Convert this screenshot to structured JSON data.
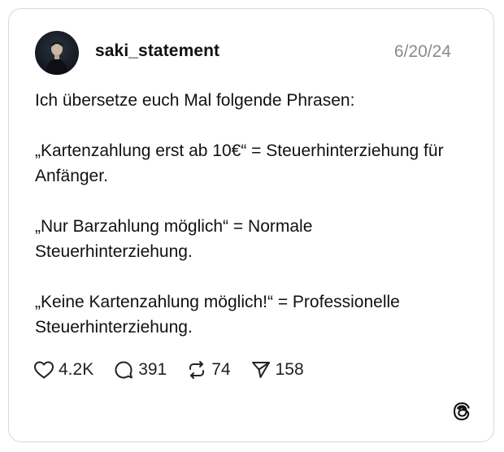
{
  "post": {
    "username": "saki_statement",
    "date": "6/20/24",
    "paragraphs": [
      "Ich übersetze euch Mal folgende Phrasen:",
      "„Kartenzahlung erst ab 10€“ = Steuerhinterziehung für Anfänger.",
      "„Nur Barzahlung möglich“ = Normale Steuerhinterziehung.",
      "„Keine Kartenzahlung möglich!“ = Professionelle Steuerhinterziehung."
    ],
    "stats": {
      "likes": "4.2K",
      "replies": "391",
      "reposts": "74",
      "shares": "158"
    }
  },
  "icons": {
    "like": "heart-icon",
    "reply": "comment-bubble-icon",
    "repost": "repost-icon",
    "share": "send-icon",
    "brand": "threads-logo-icon"
  },
  "colors": {
    "text": "#111111",
    "muted": "#8a8a8a",
    "border": "#d9d9d9"
  }
}
